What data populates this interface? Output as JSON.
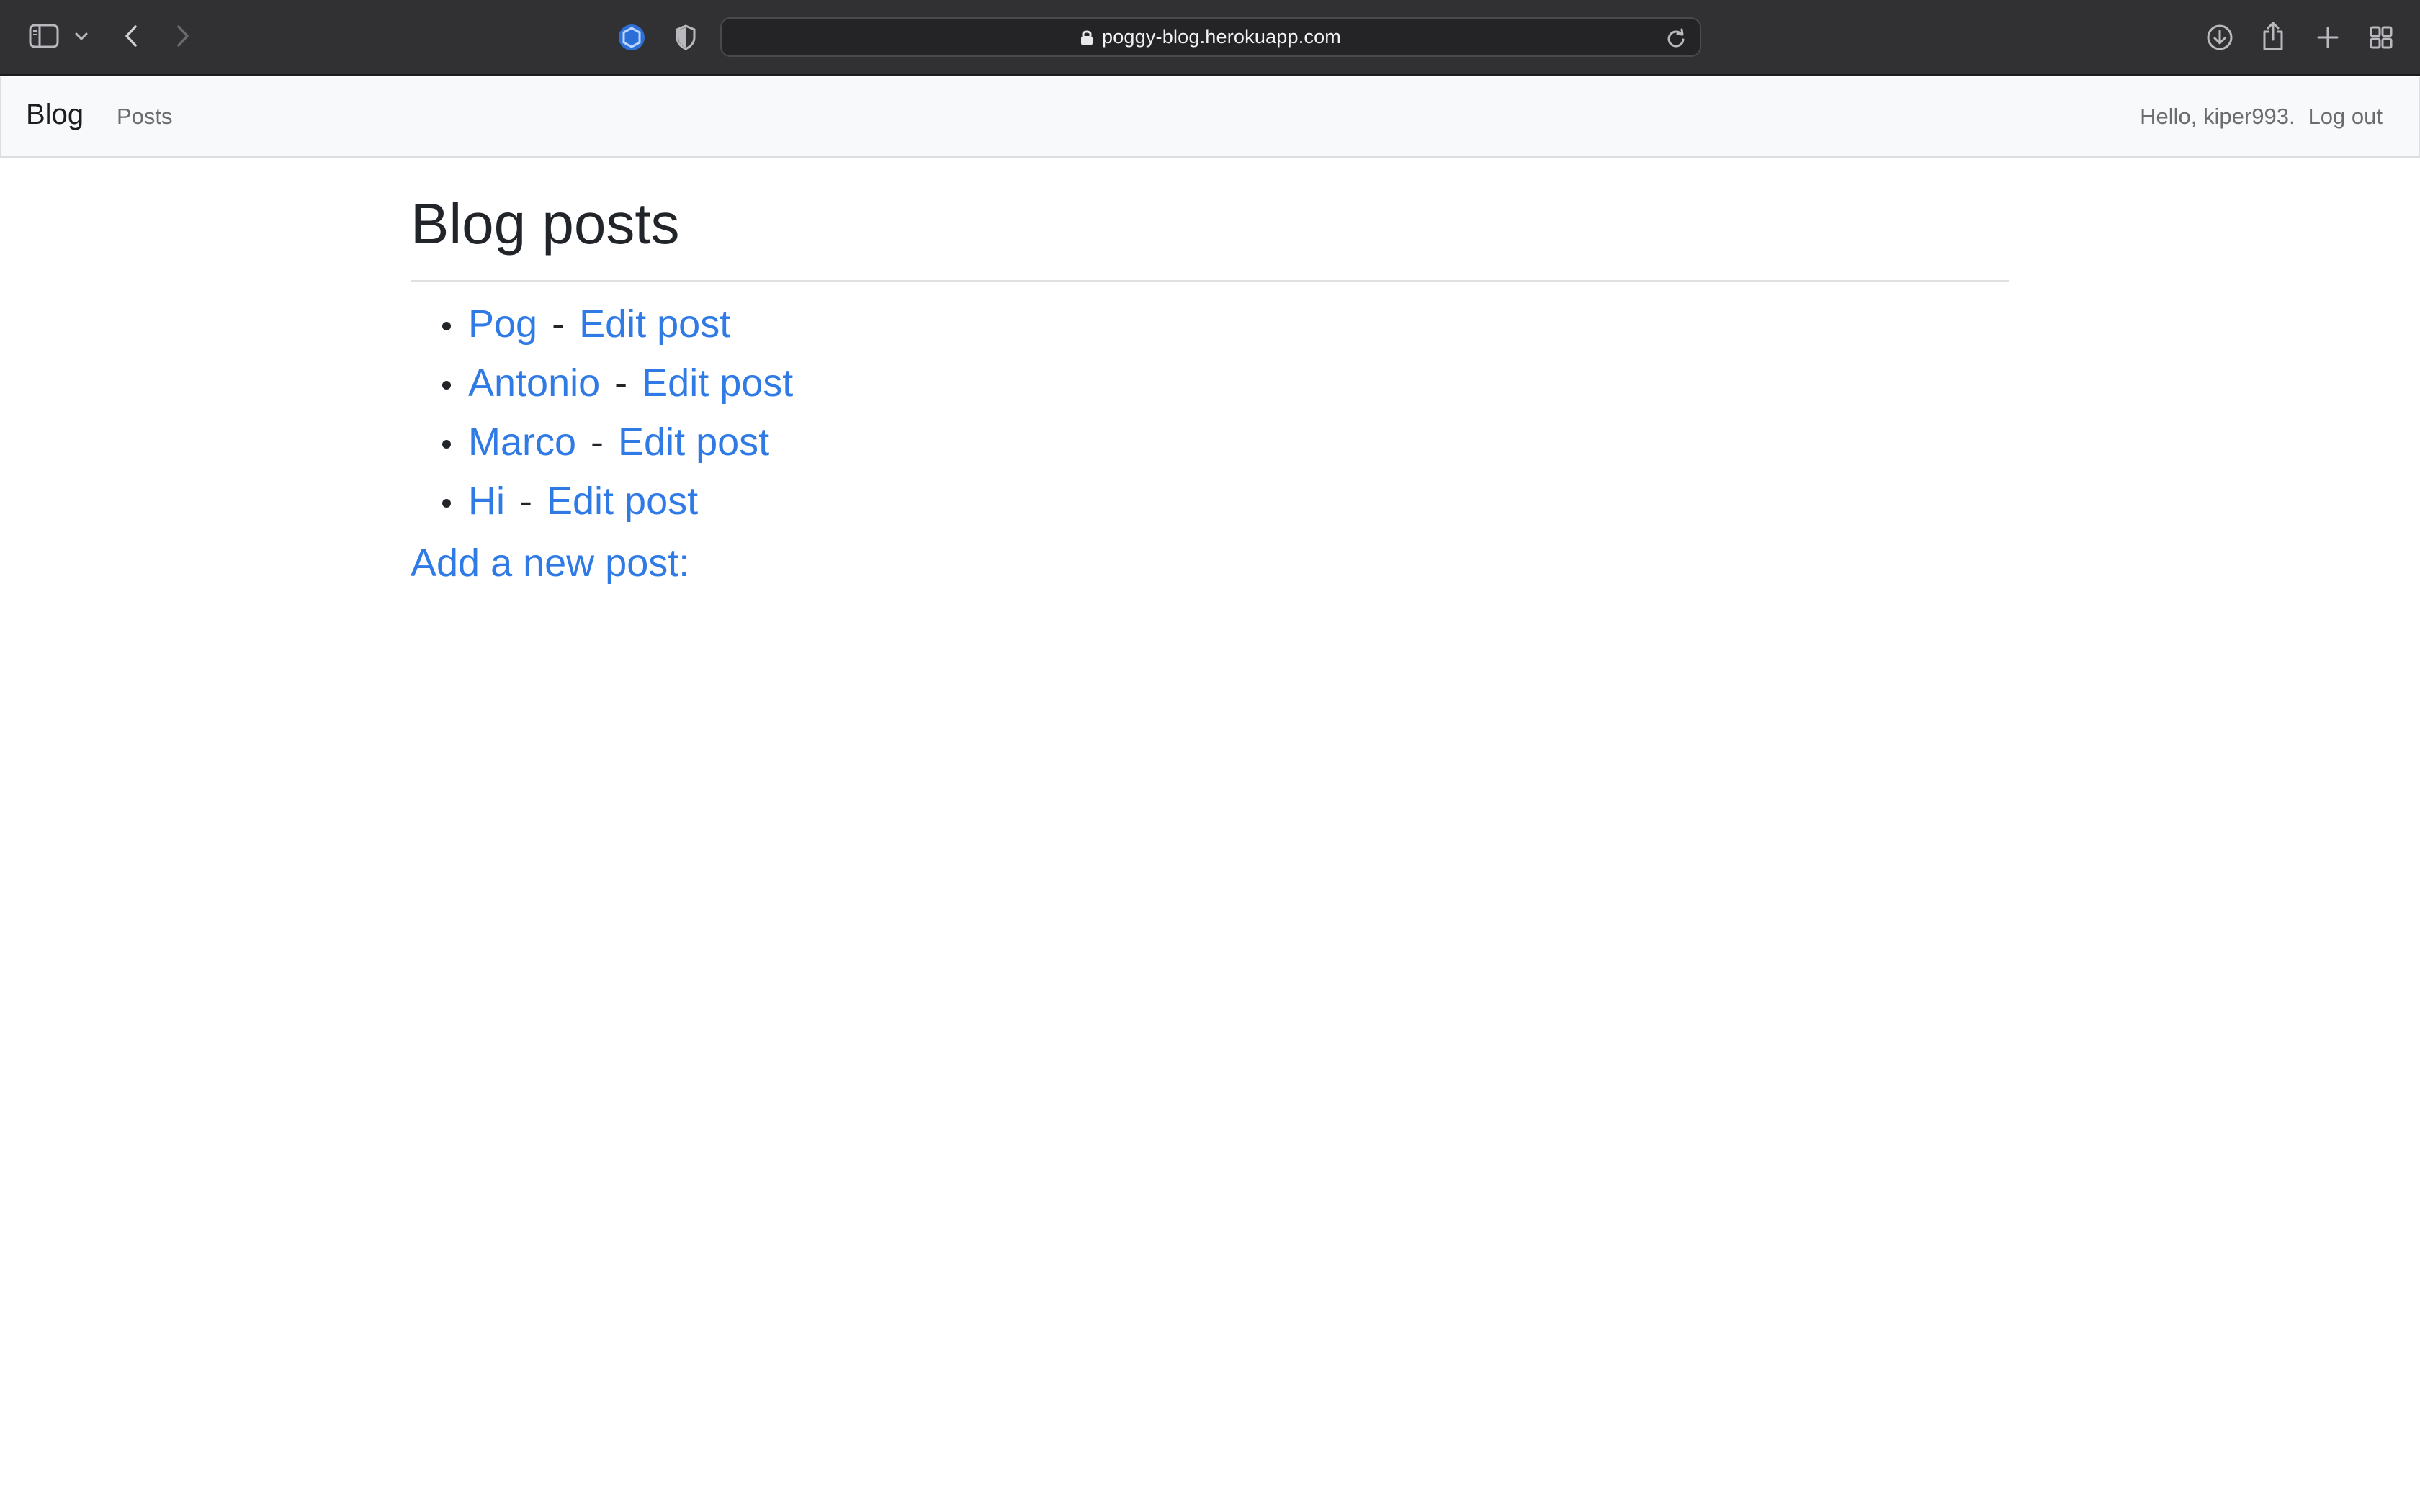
{
  "browser": {
    "url": "poggy-blog.herokuapp.com"
  },
  "navbar": {
    "brand": "Blog",
    "posts_link": "Posts",
    "greeting": "Hello, kiper993.",
    "logout": "Log out"
  },
  "main": {
    "title": "Blog posts",
    "posts": [
      {
        "title": "Pog",
        "separator": "-",
        "edit": "Edit post"
      },
      {
        "title": "Antonio",
        "separator": "-",
        "edit": "Edit post"
      },
      {
        "title": "Marco",
        "separator": "-",
        "edit": "Edit post"
      },
      {
        "title": "Hi",
        "separator": "-",
        "edit": "Edit post"
      }
    ],
    "add_new": "Add a new post:"
  },
  "colors": {
    "chrome_bg": "#313033",
    "link": "#2f7ae5",
    "navbar_bg": "#f8f9fa"
  },
  "icons": {
    "sidebar": "sidebar-icon",
    "tabs_chevron": "chevron-down-icon",
    "back": "chevron-left-icon",
    "forward": "chevron-right-icon",
    "extension": "extension-icon",
    "privacy": "shield-icon",
    "lock": "lock-icon",
    "reload": "reload-icon",
    "downloads": "download-icon",
    "share": "share-icon",
    "new_tab": "plus-icon",
    "tab_overview": "grid-icon"
  }
}
